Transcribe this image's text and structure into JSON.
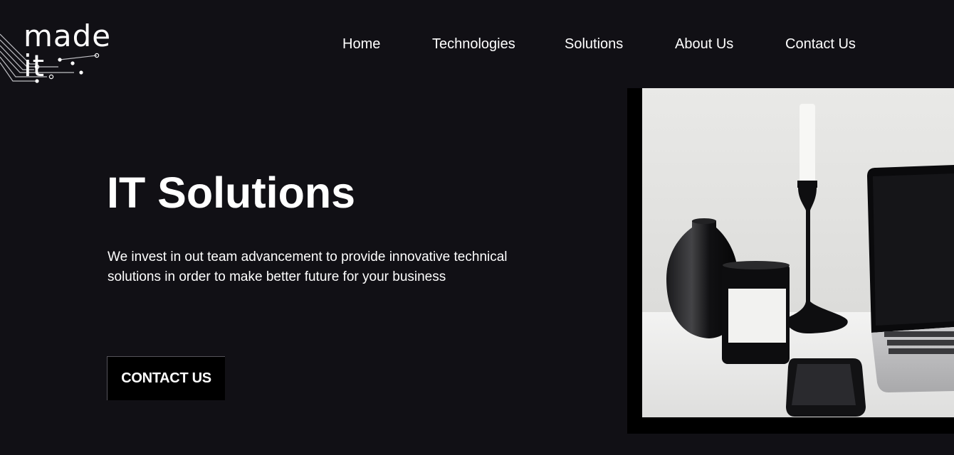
{
  "header": {
    "logo_text": "made it",
    "nav": [
      "Home",
      "Technologies",
      "Solutions",
      "About Us",
      "Contact Us"
    ]
  },
  "hero": {
    "title": "IT Solutions",
    "description": "We invest in out team advancement to provide innovative technical solutions in order to make better future for your business",
    "cta_label": "CONTACT US",
    "image_icon": "desk-photo"
  },
  "colors": {
    "background": "#111015",
    "text": "#ffffff",
    "cta_background": "#000000"
  }
}
